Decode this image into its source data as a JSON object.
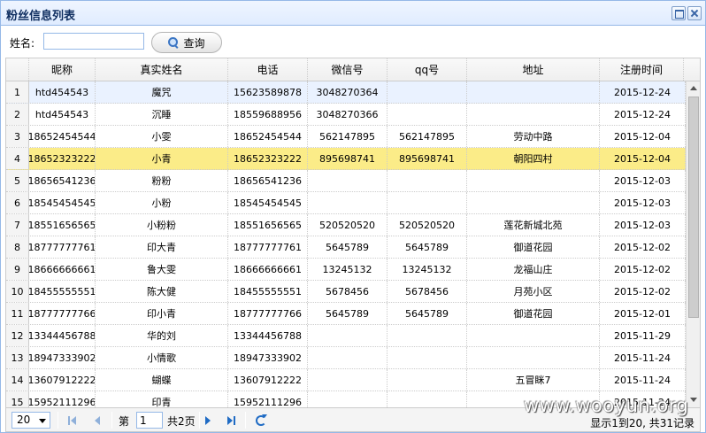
{
  "window": {
    "title": "粉丝信息列表"
  },
  "search": {
    "label": "姓名:",
    "value": "",
    "button_label": "查询"
  },
  "columns": [
    "昵称",
    "真实姓名",
    "电话",
    "微信号",
    "qq号",
    "地址",
    "注册时间"
  ],
  "rows": [
    {
      "n": "1",
      "nick": "htd454543",
      "name": "魔咒",
      "phone": "15623589878",
      "wechat": "3048270364",
      "qq": "",
      "addr": "",
      "date": "2015-12-24"
    },
    {
      "n": "2",
      "nick": "htd454543",
      "name": "沉睡",
      "phone": "18559688956",
      "wechat": "3048270366",
      "qq": "",
      "addr": "",
      "date": "2015-12-24"
    },
    {
      "n": "3",
      "nick": "18652454544",
      "name": "小雯",
      "phone": "18652454544",
      "wechat": "562147895",
      "qq": "562147895",
      "addr": "劳动中路",
      "date": "2015-12-04"
    },
    {
      "n": "4",
      "nick": "18652323222",
      "name": "小青",
      "phone": "18652323222",
      "wechat": "895698741",
      "qq": "895698741",
      "addr": "朝阳四村",
      "date": "2015-12-04"
    },
    {
      "n": "5",
      "nick": "18656541236",
      "name": "粉粉",
      "phone": "18656541236",
      "wechat": "",
      "qq": "",
      "addr": "",
      "date": "2015-12-03"
    },
    {
      "n": "6",
      "nick": "18545454545",
      "name": "小粉",
      "phone": "18545454545",
      "wechat": "",
      "qq": "",
      "addr": "",
      "date": "2015-12-03"
    },
    {
      "n": "7",
      "nick": "18551656565",
      "name": "小粉粉",
      "phone": "18551656565",
      "wechat": "520520520",
      "qq": "520520520",
      "addr": "莲花新城北苑",
      "date": "2015-12-03"
    },
    {
      "n": "8",
      "nick": "18777777761",
      "name": "印大青",
      "phone": "18777777761",
      "wechat": "5645789",
      "qq": "5645789",
      "addr": "御道花园",
      "date": "2015-12-02"
    },
    {
      "n": "9",
      "nick": "18666666661",
      "name": "鲁大雯",
      "phone": "18666666661",
      "wechat": "13245132",
      "qq": "13245132",
      "addr": "龙福山庄",
      "date": "2015-12-02"
    },
    {
      "n": "10",
      "nick": "18455555551",
      "name": "陈大健",
      "phone": "18455555551",
      "wechat": "5678456",
      "qq": "5678456",
      "addr": "月苑小区",
      "date": "2015-12-02"
    },
    {
      "n": "11",
      "nick": "18777777766",
      "name": "印小青",
      "phone": "18777777766",
      "wechat": "5645789",
      "qq": "5645789",
      "addr": "御道花园",
      "date": "2015-12-01"
    },
    {
      "n": "12",
      "nick": "13344456788",
      "name": "华的刘",
      "phone": "13344456788",
      "wechat": "",
      "qq": "",
      "addr": "",
      "date": "2015-11-29"
    },
    {
      "n": "13",
      "nick": "18947333902",
      "name": "小情歌",
      "phone": "18947333902",
      "wechat": "",
      "qq": "",
      "addr": "",
      "date": "2015-11-24"
    },
    {
      "n": "14",
      "nick": "13607912222",
      "name": "蝴蝶",
      "phone": "13607912222",
      "wechat": "",
      "qq": "",
      "addr": "五冒眯7",
      "date": "2015-11-24"
    },
    {
      "n": "15",
      "nick": "15952111296",
      "name": "印青",
      "phone": "15952111296",
      "wechat": "",
      "qq": "",
      "addr": "",
      "date": "2015-11-24"
    }
  ],
  "pager": {
    "page_size": "20",
    "page_prefix": "第",
    "page_value": "1",
    "page_suffix": "共2页",
    "info": "显示1到20, 共31记录"
  },
  "watermark": "www.wooyun.org",
  "colors": {
    "header_border": "#95b8e7",
    "selected_row": "#fbec88",
    "hover_row": "#eaf2ff"
  }
}
